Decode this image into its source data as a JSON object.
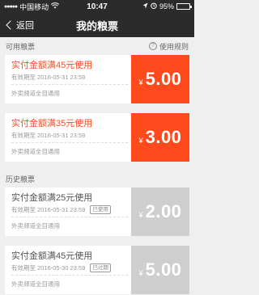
{
  "status": {
    "carrier": "中国移动",
    "time": "10:47",
    "battery": "95%",
    "signal_dots": "●●●●●",
    "icons": [
      "wifi-icon",
      "location-icon",
      "alarm-icon",
      "battery-icon"
    ]
  },
  "nav": {
    "back_label": "返回",
    "title": "我的粮票"
  },
  "available_section": {
    "label": "可用粮票",
    "rules_label": "使用规则",
    "rules_icon": "?"
  },
  "history_section": {
    "label": "历史粮票"
  },
  "colors": {
    "accent": "#ff4a1e",
    "header_bg": "#2b2b2b",
    "expired_bg": "#cfcfcf"
  },
  "coupons_available": [
    {
      "title": "实付金额满45元使用",
      "expiry": "有效期至 2016-05-31 23:59",
      "scope": "外卖频道全目通用",
      "currency": "¥",
      "amount": "5.00"
    },
    {
      "title": "实付金额满35元使用",
      "expiry": "有效期至 2016-05-31 23:59",
      "scope": "外卖频道全目通用",
      "currency": "¥",
      "amount": "3.00"
    }
  ],
  "coupons_history": [
    {
      "title": "实付金额满25元使用",
      "expiry": "有效期至 2016-05-31 23:59",
      "stamp": "已使用",
      "scope": "外卖频道全目通用",
      "currency": "¥",
      "amount": "2.00"
    },
    {
      "title": "实付金额满45元使用",
      "expiry": "有效期至 2016-05-30 23:59",
      "stamp": "已过期",
      "scope": "外卖频道全目通用",
      "currency": "¥",
      "amount": "5.00"
    }
  ]
}
